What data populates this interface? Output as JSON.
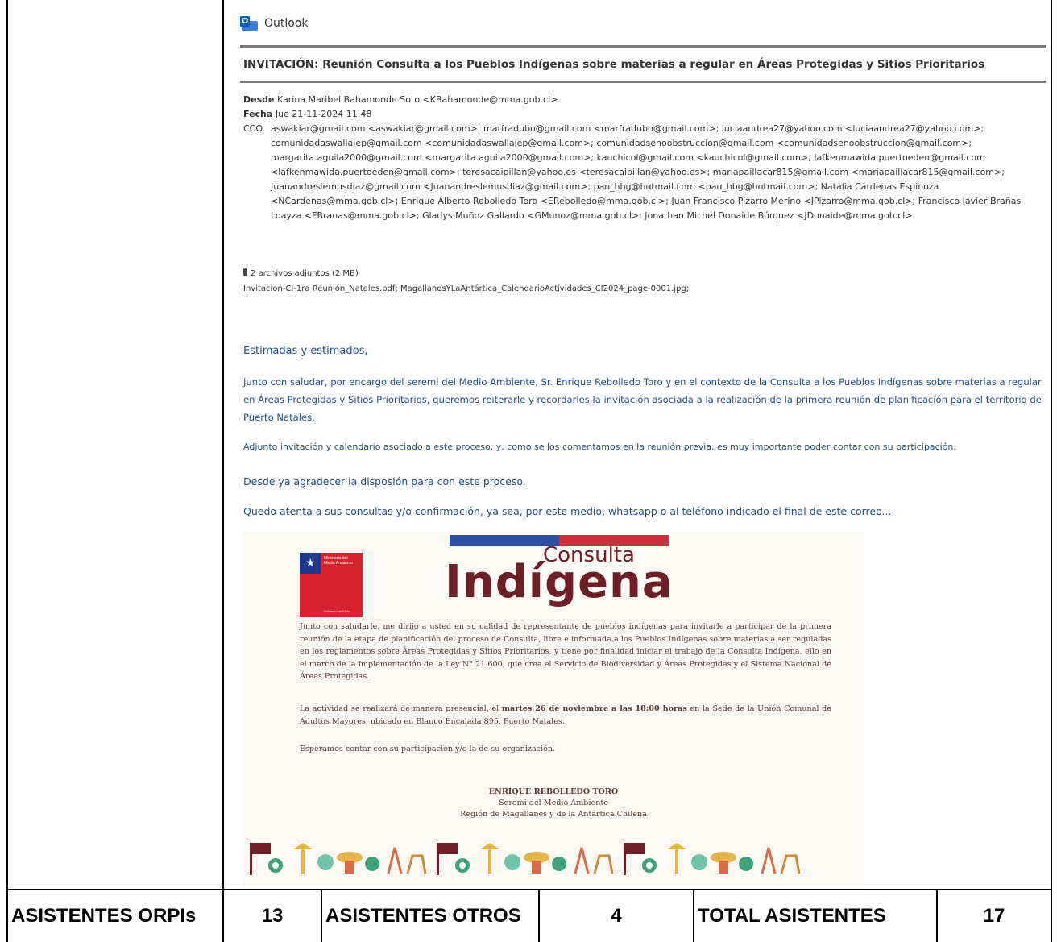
{
  "app": {
    "name": "Outlook"
  },
  "email": {
    "subject": "INVITACIÓN: Reunión Consulta a los Pueblos Indígenas sobre materias a regular en Áreas Protegidas y Sitios Prioritarios",
    "from_label": "Desde",
    "from_value": "Karina Maribel Bahamonde Soto <KBahamonde@mma.gob.cl>",
    "date_label": "Fecha",
    "date_value": "Jue 21-11-2024 11:48",
    "cco_label": "CCO",
    "cco_value": "aswakiar@gmail.com <aswakiar@gmail.com>; marfradubo@gmail.com <marfradubo@gmail.com>; luciaandrea27@yahoo.com <luciaandrea27@yahoo.com>; comunidadaswallajep@gmail.com <comunidadaswallajep@gmail.com>; comunidadsenoobstruccion@gmail.com <comunidadsenoobstruccion@gmail.com>; margarita.aguila2000@gmail.com <margarita.aguila2000@gmail.com>; kauchicol@gmail.com <kauchicol@gmail.com>; lafkenmawida.puertoeden@gmail.com <lafkenmawida.puertoeden@gmail.com>; teresacaipillan@yahoo.es <teresacaipillan@yahoo.es>; mariapaillacar815@gmail.com <mariapaillacar815@gmail.com>; Juanandreslemusdiaz@gmail.com <Juanandreslemusdiaz@gmail.com>; pao_hbg@hotmail.com <pao_hbg@hotmail.com>; Natalia Cárdenas Espinoza <NCardenas@mma.gob.cl>; Enrique Alberto Rebolledo Toro <ERebolledo@mma.gob.cl>; Juan Francisco Pizarro Merino <JPizarro@mma.gob.cl>; Francisco Javier Brañas Loayza <FBranas@mma.gob.cl>; Gladys Muñoz Gallardo <GMunoz@mma.gob.cl>; Jonathan Michel Donaide Bórquez <JDonaide@mma.gob.cl>",
    "attachments_summary": "2 archivos adjuntos (2 MB)",
    "attachments_files": "Invitacion-CI-1ra Reunión_Natales.pdf; MagallanesYLaAntártica_CalendarioActividades_CI2024_page-0001.jpg;",
    "greeting": "Estimadas y estimados,",
    "paragraph_1": "Junto con saludar, por encargo del seremi del Medio Ambiente, Sr. Enrique Rebolledo Toro y en el contexto de la Consulta a los Pueblos Indígenas sobre materias a regular en Áreas Protegidas y Sitios Prioritarios, queremos reiterarle y recordarles la invitación asociada a la realización de la primera reunión de planificación para el territorio de Puerto Natales.",
    "paragraph_2": "Adjunto invitación y calendario asociado a este proceso, y, como se los comentamos en la reunión previa, es muy importante poder contar con su participación.",
    "paragraph_3": "Desde ya agradecer la disposión para con este proceso.",
    "paragraph_4": "Quedo atenta a sus consultas y/o confirmación, ya sea, por este medio, whatsapp o al teléfono indicado el final de este correo..."
  },
  "invitation": {
    "title_small": "Consulta",
    "title_big": "Indígena",
    "logo_text": "Ministerio del Medio Ambiente",
    "logo_bottom": "Gobierno de Chile",
    "para_1": "Junto con saludarle, me dirijo a usted en su calidad de representante de pueblos indígenas para invitarle a participar de la primera reunión de la etapa de planificación del proceso de Consulta, libre e informada a los Pueblos Indígenas sobre materias a ser reguladas en los reglamentos sobre Áreas Protegidas y Sitios Prioritarios, y tiene por finalidad iniciar el trabajo de la Consulta Indígena, ello en el marco de la implementación de la Ley N° 21.600, que crea el Servicio de Biodiversidad y Áreas Protegidas y el Sistema Nacional de Áreas Protegidas.",
    "para_2_pre": "La actividad se realizará de manera presencial, el ",
    "para_2_bold": "martes 26 de noviembre a las 18:00 horas",
    "para_2_post": " en la Sede de la Unión Comunal de Adultos Mayores, ubicado en Blanco Encalada 895, Puerto Natales.",
    "para_3": "Esperamos contar con su participación y/o la de su organización.",
    "signer_name": "ENRIQUE REBOLLEDO TORO",
    "signer_role": "Seremi del Medio Ambiente",
    "signer_region": "Región de Magallanes y de la Antártica Chilena"
  },
  "totals": {
    "label_orpis": "ASISTENTES ORPIs",
    "value_orpis": "13",
    "label_otros": "ASISTENTES OTROS",
    "value_otros": "4",
    "label_total": "TOTAL ASISTENTES",
    "value_total": "17"
  },
  "colors": {
    "body_text": "#1f4e8c",
    "brand_maroon": "#6e1e25",
    "flag_blue": "#2b4fa3",
    "flag_red": "#d12d3a"
  },
  "icons": [
    "outlook-icon",
    "paperclip-icon"
  ]
}
